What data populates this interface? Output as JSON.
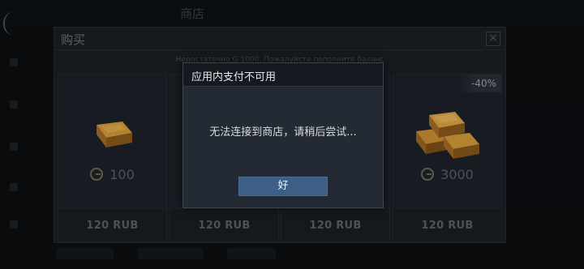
{
  "header": {
    "title": "商店",
    "stat_1": "",
    "stat_2": ""
  },
  "shop": {
    "title": "购买",
    "notice": "Недостаточно G 1000. Пожалуйста пополните баланс",
    "cards": [
      {
        "amount": "100",
        "price": "120 RUB",
        "discount": "",
        "icon": "gold-bar-single-icon"
      },
      {
        "amount": "",
        "price": "120 RUB",
        "discount": "",
        "icon": ""
      },
      {
        "amount": "",
        "price": "120 RUB",
        "discount": "",
        "icon": ""
      },
      {
        "amount": "3000",
        "price": "120 RUB",
        "discount": "-40%",
        "icon": "gold-bars-stack-icon"
      }
    ],
    "currency_icon": "gold-coin-icon"
  },
  "dialog": {
    "title": "应用内支付不可用",
    "message": "无法连接到商店，请稍后尝试...",
    "ok_label": "好"
  },
  "colors": {
    "dialog_button": "#3d5f86",
    "panel_bg": "#1b1f24",
    "gold": "#b8842a"
  }
}
